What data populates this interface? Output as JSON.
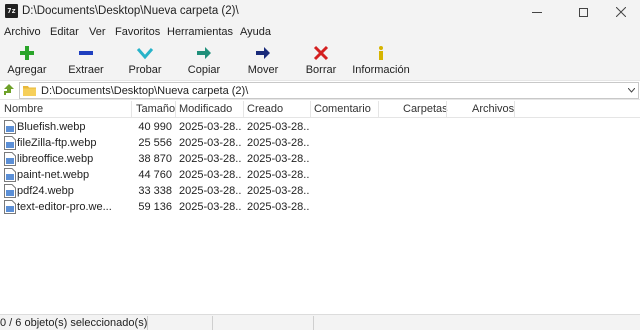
{
  "window": {
    "app_icon_text": "7z",
    "title": "D:\\Documents\\Desktop\\Nueva carpeta (2)\\"
  },
  "menu": {
    "items": [
      "Archivo",
      "Editar",
      "Ver",
      "Favoritos",
      "Herramientas",
      "Ayuda"
    ]
  },
  "toolbar": {
    "buttons": [
      {
        "label": "Agregar",
        "icon": "plus-icon",
        "color": "#2aa52a"
      },
      {
        "label": "Extraer",
        "icon": "minus-icon",
        "color": "#1f3fbf"
      },
      {
        "label": "Probar",
        "icon": "check-icon",
        "color": "#27b3c9"
      },
      {
        "label": "Copiar",
        "icon": "copy-arrow-icon",
        "color": "#1f8f7a"
      },
      {
        "label": "Mover",
        "icon": "move-arrow-icon",
        "color": "#1a2b7a"
      },
      {
        "label": "Borrar",
        "icon": "delete-x-icon",
        "color": "#d42020"
      },
      {
        "label": "Información",
        "icon": "info-icon",
        "color": "#d6b400"
      }
    ]
  },
  "address": {
    "path": "D:\\Documents\\Desktop\\Nueva carpeta (2)\\"
  },
  "columns": {
    "name": "Nombre",
    "size": "Tamaño",
    "modified": "Modificado",
    "created": "Creado",
    "comment": "Comentario",
    "folders": "Carpetas",
    "files": "Archivos"
  },
  "files": [
    {
      "name": "Bluefish.webp",
      "size": "40 990",
      "modified": "2025-03-28...",
      "created": "2025-03-28..."
    },
    {
      "name": "fileZilla-ftp.webp",
      "size": "25 556",
      "modified": "2025-03-28...",
      "created": "2025-03-28..."
    },
    {
      "name": "libreoffice.webp",
      "size": "38 870",
      "modified": "2025-03-28...",
      "created": "2025-03-28..."
    },
    {
      "name": "paint-net.webp",
      "size": "44 760",
      "modified": "2025-03-28...",
      "created": "2025-03-28..."
    },
    {
      "name": "pdf24.webp",
      "size": "33 338",
      "modified": "2025-03-28...",
      "created": "2025-03-28..."
    },
    {
      "name": "text-editor-pro.we...",
      "size": "59 136",
      "modified": "2025-03-28...",
      "created": "2025-03-28..."
    }
  ],
  "status": {
    "selection": "0 / 6 objeto(s) seleccionado(s)"
  }
}
